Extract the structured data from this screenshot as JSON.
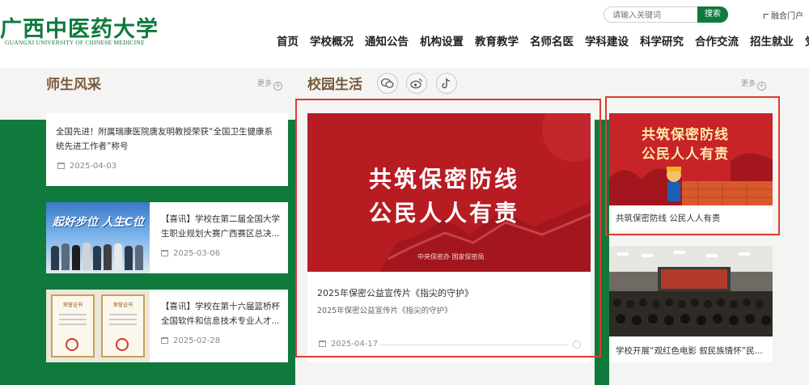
{
  "header": {
    "logo_cn": "广西中医药大学",
    "logo_en": "GUANGXI UNIVERSITY OF CHINESE MEDICINE",
    "search_placeholder": "请输入关键词",
    "search_button": "搜索",
    "portal_link": "融合门户",
    "nav": [
      "首页",
      "学校概况",
      "通知公告",
      "机构设置",
      "教育教学",
      "名师名医",
      "学科建设",
      "科学研究",
      "合作交流",
      "招生就业",
      "党建"
    ]
  },
  "faculty": {
    "title": "师生风采",
    "more": "更多",
    "items": [
      {
        "title": "全国先进！附属瑞康医院唐友明教授荣获“全国卫生健康系统先进工作者”称号",
        "date": "2025-04-03"
      },
      {
        "title": "【喜讯】学校在第二届全国大学生职业规划大赛广西赛区总决...",
        "date": "2025-03-06",
        "thumb_text": "起好步位 人生C位"
      },
      {
        "title": "【喜讯】学校在第十六届蓝桥杯全国软件和信息技术专业人才...",
        "date": "2025-02-28",
        "thumb_text": "荣誉证书"
      }
    ]
  },
  "campus": {
    "title": "校园生活",
    "more": "更多",
    "social_icons": [
      "wechat-icon",
      "weibo-icon",
      "tiktok-icon"
    ],
    "featured": {
      "slogan_line1": "共筑保密防线",
      "slogan_line2": "公民人人有责",
      "org": "中央保密办 国家保密局",
      "title": "2025年保密公益宣传片《指尖的守护》",
      "subtitle": "2025年保密公益宣传片《指尖的守护》",
      "date": "2025-04-17"
    },
    "side_items": [
      {
        "title": "共筑保密防线 公民人人有责",
        "slogan_line1": "共筑保密防线",
        "slogan_line2": "公民人人有责"
      },
      {
        "title": "学校开展“观红色电影 叙民族情怀”民..."
      }
    ]
  },
  "colors": {
    "brand_green": "#0f7a3c",
    "accent_red": "#b81c23",
    "title_brown": "#7a5a3b",
    "highlight_border": "#e03a30"
  }
}
